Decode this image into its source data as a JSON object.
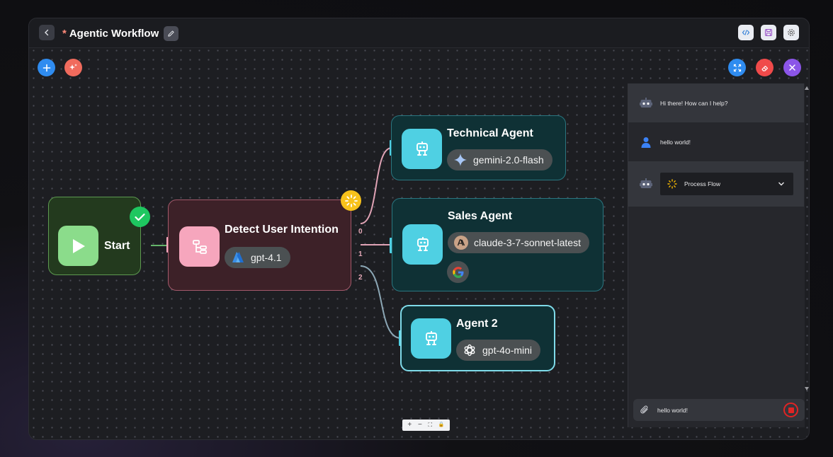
{
  "header": {
    "unsaved_mark": "*",
    "title": "Agentic Workflow"
  },
  "toolbar_icons": [
    "back-icon",
    "edit-icon",
    "code-icon",
    "save-icon",
    "settings-icon"
  ],
  "canvas_buttons": {
    "add": "plus-icon",
    "ai_generate": "sparkle-icon",
    "fullscreen": "expand-icon",
    "clear": "eraser-icon",
    "close": "close-icon"
  },
  "nodes": {
    "start": {
      "label": "Start",
      "status": "completed"
    },
    "detect": {
      "label": "Detect User Intention",
      "model": "gpt-4.1",
      "outputs": [
        "0",
        "1",
        "2"
      ],
      "status": "running"
    },
    "technical": {
      "label": "Technical Agent",
      "model": "gemini-2.0-flash"
    },
    "sales": {
      "label": "Sales Agent",
      "model": "claude-3-7-sonnet-latest"
    },
    "agent2": {
      "label": "Agent 2",
      "model": "gpt-4o-mini"
    }
  },
  "chat": {
    "messages": [
      {
        "role": "bot",
        "text": "Hi there! How can I help?"
      },
      {
        "role": "user",
        "text": "hello world!"
      },
      {
        "role": "bot",
        "process_label": "Process Flow"
      }
    ],
    "input_value": "hello world!"
  },
  "zoom_controls": [
    "+",
    "−",
    "⛶",
    "🔒"
  ],
  "colors": {
    "start_node": "#233a1e",
    "start_icon": "#8bdc8b",
    "detect_node": "#3d2128",
    "detect_icon": "#f6a6bd",
    "agent_node": "#0f3135",
    "agent_icon": "#4fd0e3",
    "agent_border": "#2a7680",
    "selected_border": "#7fdbe9",
    "check_green": "#1ec760",
    "spinner_yellow": "#f8c21b"
  }
}
